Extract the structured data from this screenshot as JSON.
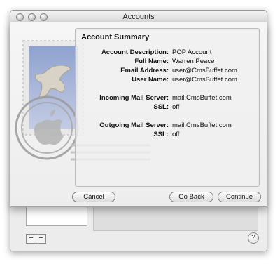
{
  "window": {
    "title": "Accounts"
  },
  "summary": {
    "heading": "Account Summary",
    "rows": [
      {
        "label": "Account Description:",
        "value": "POP Account"
      },
      {
        "label": "Full Name:",
        "value": "Warren Peace"
      },
      {
        "label": "Email Address:",
        "value": "user@CmsBuffet.com"
      },
      {
        "label": "User Name:",
        "value": "user@CmsBuffet.com"
      },
      {
        "label": "Incoming Mail Server:",
        "value": "mail.CmsBuffet.com"
      },
      {
        "label": "SSL:",
        "value": "off"
      },
      {
        "label": "Outgoing Mail Server:",
        "value": "mail.CmsBuffet.com"
      },
      {
        "label": "SSL:",
        "value": "off"
      }
    ]
  },
  "buttons": {
    "cancel": "Cancel",
    "go_back": "Go Back",
    "continue": "Continue"
  },
  "account_list": {
    "add": "+",
    "remove": "−"
  },
  "help": "?",
  "icons": {
    "stamp": "stamp-illustration",
    "postmark": "postmark-icon",
    "apple": "apple-logo-icon"
  }
}
